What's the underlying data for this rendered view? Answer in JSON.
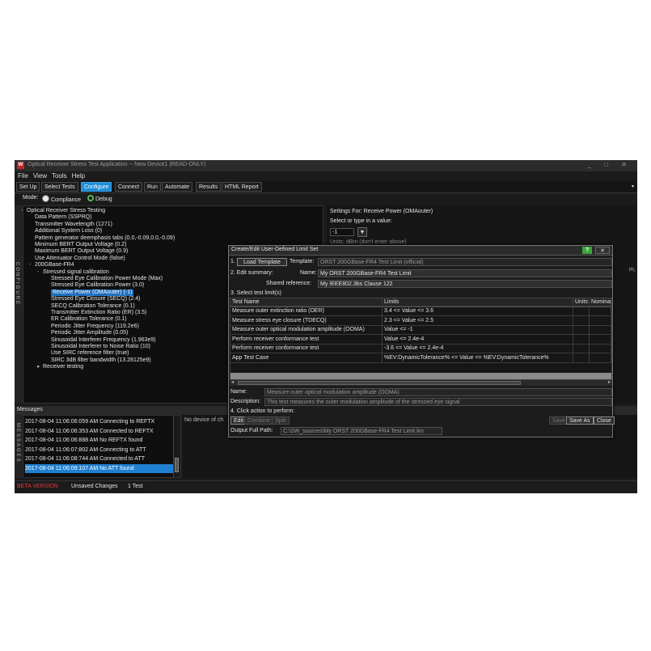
{
  "window": {
    "title": "Optical Receiver Stress Test Application -- New Device1 (READ-ONLY)",
    "logo": "W",
    "controls": "_ □ ✕"
  },
  "menu": [
    "File",
    "View",
    "Tools",
    "Help"
  ],
  "tabs": [
    {
      "label": "Set Up",
      "active": false
    },
    {
      "label": "Select Tests",
      "active": false
    },
    {
      "label": "Configure",
      "active": true
    },
    {
      "label": "Connect",
      "active": false
    },
    {
      "label": "Run",
      "active": false
    },
    {
      "label": "Automate",
      "active": false
    },
    {
      "label": "Results",
      "active": false
    },
    {
      "label": "HTML Report",
      "active": false
    }
  ],
  "mode": {
    "label": "Mode:",
    "compliance": "Compliance",
    "debug": "Debug"
  },
  "side_labels": {
    "configure": "CONFIGURE",
    "messages": "MESSAGES"
  },
  "tree": [
    {
      "text": "Optical Receiver Stress Testing",
      "indent": 0,
      "prefix": "-"
    },
    {
      "text": "Data Pattern (SSPRQ)",
      "indent": 1
    },
    {
      "text": "Transmitter Wavelength (1271)",
      "indent": 1
    },
    {
      "text": "Additional System Loss (0)",
      "indent": 1
    },
    {
      "text": "Pattern generator deemphasis tabs (0.0,-0.09,0.0,-0.09)",
      "indent": 1
    },
    {
      "text": "Minimum BERT Output Voltage (0.2)",
      "indent": 1
    },
    {
      "text": "Maximum BERT Output Voltage (0.9)",
      "indent": 1
    },
    {
      "text": "Use Attenuator Control Mode (false)",
      "indent": 1
    },
    {
      "text": "200GBase-FR4",
      "indent": 1,
      "prefix": "-"
    },
    {
      "text": "Stressed signal calibration",
      "indent": 2,
      "prefix": "-"
    },
    {
      "text": "Stressed Eye Calibration Power Mode (Max)",
      "indent": 3
    },
    {
      "text": "Stressed Eye Calibration Power (3.0)",
      "indent": 3
    },
    {
      "text": "Receive Power (OMAouter) (-1)",
      "indent": 3,
      "selected": true
    },
    {
      "text": "Stressed Eye Closure (SECQ) (2.4)",
      "indent": 3
    },
    {
      "text": "SECQ Calibration Tolerance (0.1)",
      "indent": 3
    },
    {
      "text": "Transmitter Extinction Ratio (ER) (3.5)",
      "indent": 3
    },
    {
      "text": "ER Calibration Tolerance (0.1)",
      "indent": 3
    },
    {
      "text": "Periodic Jitter Frequency (119.2e6)",
      "indent": 3
    },
    {
      "text": "Periodic Jitter Amplitude (0.05)",
      "indent": 3
    },
    {
      "text": "Sinusoidal Interferer Frequency (1.963e9)",
      "indent": 3
    },
    {
      "text": "Sinusoidal Interferer to Noise Ratio (10)",
      "indent": 3
    },
    {
      "text": "Use SIRC reference filter (true)",
      "indent": 3
    },
    {
      "text": "SIRC 3dB filter bandwidth (13.28125e9)",
      "indent": 3
    },
    {
      "text": "Receiver testing",
      "indent": 2,
      "prefix": "▸"
    }
  ],
  "settings": {
    "title": "Settings For: Receive Power (OMAouter)",
    "prompt": "Select or type in a value:",
    "value": "-1",
    "units_hint": "Units: dBm  (don't enter above)",
    "tail": "m,"
  },
  "messages": {
    "header": "Messages",
    "items": [
      {
        "text": "2017-08-04 11:06:06:059 AM Connecting to REFTX",
        "selected": false
      },
      {
        "text": "2017-08-04 11:06:06:353 AM Connected to REFTX",
        "selected": false
      },
      {
        "text": "2017-08-04 11:06:06:888 AM No REFTX found",
        "selected": false
      },
      {
        "text": "2017-08-04 11:06:07:802 AM Connecting to ATT",
        "selected": false
      },
      {
        "text": "2017-08-04 11:06:08:744 AM Connected to ATT",
        "selected": false
      },
      {
        "text": "2017-08-04 11:06:09:107 AM No ATT found",
        "selected": true
      }
    ],
    "detail": "No device of ch"
  },
  "status": {
    "beta": "BETA VERSION",
    "unsaved": "Unsaved Changes",
    "tests": "1 Test"
  },
  "dialog": {
    "title": "Create/Edit User-Defined Limit Set",
    "help": "?",
    "close": "✕",
    "step1": "1.",
    "load_template": "Load Template",
    "template_label": "Template:",
    "template_value": "ORST 200GBase-FR4 Test Limit (official)",
    "step2": "2. Edit summary:",
    "name_label": "Name:",
    "name_value": "My ORST 200GBase-FR4 Test Limit",
    "shared_label": "Shared reference:",
    "shared_value": "My IEEE802.3bs Clause 122",
    "step3": "3. Select test limit(s)",
    "columns": [
      "Test Name",
      "Limits",
      "Units",
      "Nomina"
    ],
    "rows": [
      {
        "name": "Measure outer extinction ratio (OER)",
        "limit": "3.4 <= Value <= 3.6"
      },
      {
        "name": "Measure stress eye closure (TDECQ)",
        "limit": "2.3 <= Value <= 2.5"
      },
      {
        "name": "Measure outer optical modulation amplitude (OOMA)",
        "limit": "Value <= -1"
      },
      {
        "name": "Perform receiver conformance test",
        "limit": "Value <= 2.4e-4"
      },
      {
        "name": "Perform receiver conformance test",
        "limit": "-3.6 <= Value <= 2.4e-4"
      },
      {
        "name": "App Test Case",
        "limit": "%EV:DynamicTolerance% <= Value <= %EV:DynamicTolerance%"
      }
    ],
    "detail_name_label": "Name:",
    "detail_name_value": "Measure outer optical modulation amplitude (OOMA)",
    "description_label": "Description:",
    "description_value": "This test measures the outer modulation amplitude of the stressed eye signal",
    "step4": "4. Click action to perform:",
    "edit": "Edit",
    "combine": "Combine",
    "split": "Split",
    "save": "Save",
    "save_as": "Save As",
    "close_btn": "Close",
    "output_label": "Output Full Path:",
    "output_value": "C:\\SW_sources\\My ORST 200GBase-FR4 Test Limit.lim"
  }
}
